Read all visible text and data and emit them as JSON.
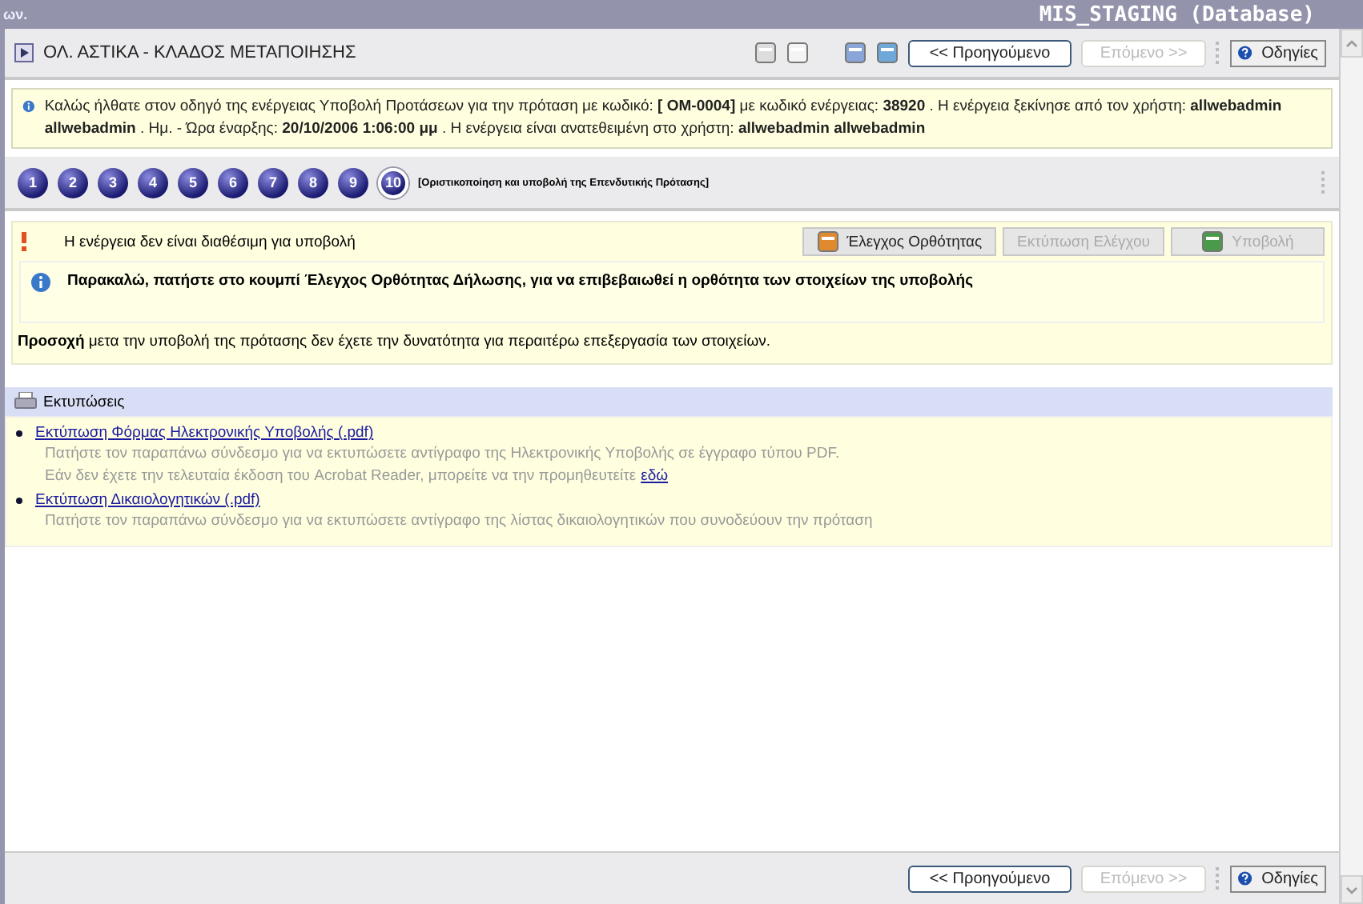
{
  "window": {
    "title_left": "ων.",
    "title": "MIS_STAGING (Database)"
  },
  "header": {
    "title": "ΟΛ. ΑΣΤΙΚΑ - ΚΛΑΔΟΣ ΜΕΤΑΠΟΙΗΣΗΣ"
  },
  "nav_buttons": [
    {
      "kind": "prev",
      "label": "<< Προηγούμενο",
      "disabled": false
    },
    {
      "kind": "next",
      "label": "Επόμενο >>",
      "disabled": true
    },
    {
      "kind": "help",
      "label": "Οδηγίες",
      "disabled": false
    }
  ],
  "info": "Καλώς ήλθατε στον οδηγό της ενέργειας Υποβολή Προτάσεων για την πρόταση με κωδικό: **[ OM-0004]** με κωδικό ενέργειας: **38920** . Η ενέργεια ξεκίνησε από τον χρήστη: **allwebadmin allwebadmin** . Ημ. - Ώρα έναρξης: **20/10/2006 1:06:00 μμ** . Η ενέργεια είναι ανατεθειμένη στο χρήστη: **allwebadmin allwebadmin**",
  "steps": [
    {
      "label": "1",
      "selected": false
    },
    {
      "label": "2",
      "selected": false
    },
    {
      "label": "3",
      "selected": false
    },
    {
      "label": "4",
      "selected": false
    },
    {
      "label": "5",
      "selected": false
    },
    {
      "label": "6",
      "selected": false
    },
    {
      "label": "7",
      "selected": false
    },
    {
      "label": "8",
      "selected": false
    },
    {
      "label": "9",
      "selected": false
    },
    {
      "label": "10",
      "selected": true
    }
  ],
  "step_title": "[Οριστικοποίηση και υποβολή της Επενδυτικής Πρότασης]",
  "warning": "Η ενέργεια δεν είναι διαθέσιμη για υποβολή",
  "action_buttons": [
    {
      "kind": "check",
      "label": "Έλεγχος Ορθότητας",
      "disabled": false
    },
    {
      "kind": "print",
      "label": "Εκτύπωση Ελέγχου",
      "disabled": true
    },
    {
      "kind": "submit",
      "label": "Υποβολή",
      "disabled": true
    }
  ],
  "instruction": "Παρακαλώ, πατήστε στο κουμπί Έλεγχος Ορθότητας Δήλωσης, για να επιβεβαιωθεί η ορθότητα των στοιχείων της υποβολής",
  "notice": "**Προσοχή** μετα την υποβολή της πρότασης δεν έχετε την δυνατότητα για περαιτέρω επεξεργασία των στοιχείων.",
  "prints": {
    "title": "Εκτυπώσεις",
    "items": [
      {
        "link": "Εκτύπωση Φόρμας Ηλεκτρονικής Υποβολής (.pdf)",
        "lines": [
          {
            "text": "Πατήστε τον παραπάνω σύνδεσμο για να εκτυπώσετε αντίγραφο της Ηλεκτρονικής Υποβολής σε έγγραφο τύπου PDF."
          },
          {
            "text": "Εάν δεν έχετε την τελευταία έκδοση του Acrobat Reader, μπορείτε να την προμηθευτείτε",
            "link": "εδώ"
          }
        ]
      },
      {
        "link": "Εκτύπωση Δικαιολογητικών (.pdf)",
        "lines": [
          {
            "text": "Πατήστε τον παραπάνω σύνδεσμο για να εκτυπώσετε αντίγραφο της λίστας δικαιολογητικών που συνοδεύουν την πρόταση"
          }
        ]
      }
    ]
  },
  "footer_buttons": [
    {
      "kind": "prev",
      "label": "<< Προηγούμενο",
      "disabled": false
    },
    {
      "kind": "next",
      "label": "Επόμενο >>",
      "disabled": true
    },
    {
      "kind": "help",
      "label": "Οδηγίες",
      "disabled": false
    }
  ]
}
